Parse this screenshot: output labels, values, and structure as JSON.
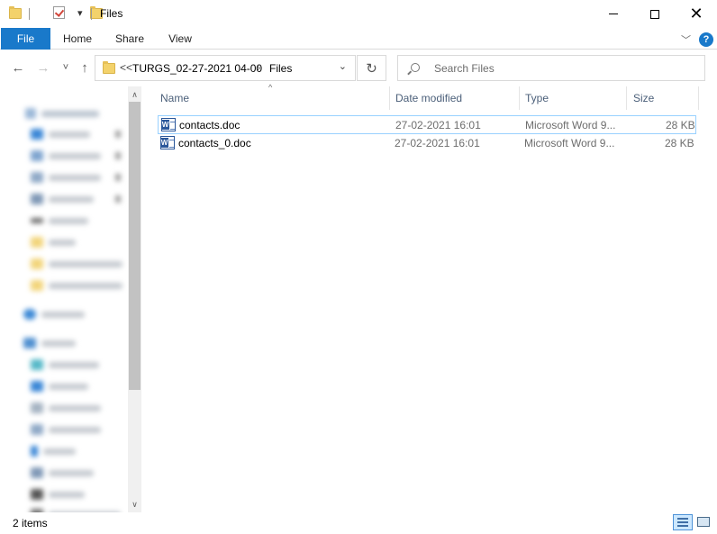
{
  "window": {
    "title": "Files",
    "minimize_icon": "minimize-icon",
    "maximize_icon": "maximize-icon",
    "close_glyph": "✕"
  },
  "quick_access_toolbar": {
    "icons": [
      "folder-icon",
      "properties-checkmark-icon",
      "new-folder-icon",
      "customize-dropdown-icon"
    ],
    "dropdown_glyph": "▾"
  },
  "ribbon": {
    "tabs": [
      {
        "label": "File",
        "active": true
      },
      {
        "label": "Home"
      },
      {
        "label": "Share"
      },
      {
        "label": "View"
      }
    ],
    "expand_glyph": "﹀",
    "help_glyph": "?",
    "accent_color": "#1979ca"
  },
  "navigation": {
    "back_glyph": "←",
    "forward_glyph": "→",
    "recent_glyph": "˅",
    "up_glyph": "↑",
    "breadcrumb": {
      "overflow": "<<",
      "segments": [
        "TURGS_02-27-2021 04-00",
        "Files"
      ],
      "separator": "›",
      "dropdown_glyph": "⌄"
    },
    "refresh_glyph": "↻",
    "search": {
      "placeholder": "Search Files"
    }
  },
  "file_list": {
    "columns": [
      {
        "label": "Name"
      },
      {
        "label": "Date modified"
      },
      {
        "label": "Type"
      },
      {
        "label": "Size"
      }
    ],
    "sort_glyph": "^",
    "rows": [
      {
        "name": "contacts.doc",
        "date_modified": "27-02-2021 16:01",
        "type": "Microsoft Word 9...",
        "size": "28 KB",
        "icon": "word-document-icon"
      },
      {
        "name": "contacts_0.doc",
        "date_modified": "27-02-2021 16:01",
        "type": "Microsoft Word 9...",
        "size": "28 KB",
        "icon": "word-document-icon"
      }
    ]
  },
  "nav_pane": {
    "scroll_up_glyph": "∧",
    "scroll_down_glyph": "∨"
  },
  "status_bar": {
    "item_count": "2 items"
  }
}
